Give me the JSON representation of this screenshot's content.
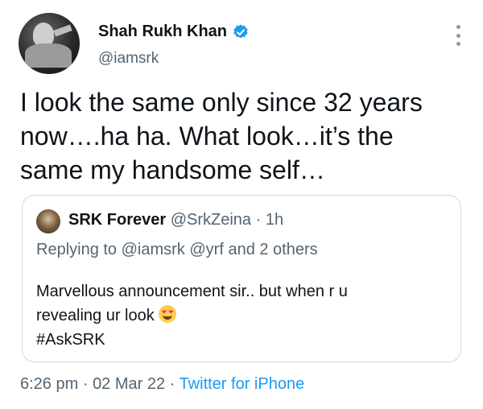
{
  "tweet": {
    "author_name": "Shah Rukh Khan",
    "author_handle": "@iamsrk",
    "text_line1": "I look the same only since 32 years",
    "text_line2": "now….ha ha. What look…it’s the",
    "text_line3": "same my handsome self…",
    "time": "6:26 pm",
    "date": "02 Mar 22",
    "source": "Twitter for iPhone",
    "separator": "·"
  },
  "quoted": {
    "author_name": "SRK Forever",
    "author_handle": "@SrkZeina",
    "age": "1h",
    "separator": "·",
    "replying_prefix": "Replying to",
    "replying_to": "@iamsrk @yrf and 2 others",
    "body_line1": "Marvellous announcement sir.. but when r u",
    "body_line2": "revealing ur look",
    "body_line3": "#AskSRK"
  },
  "icons": {
    "verified": "verified-badge-icon",
    "more": "more-options-icon",
    "emoji": "heart-eyes-emoji"
  },
  "colors": {
    "verified": "#1d9bf0",
    "link": "#1d9bf0",
    "secondary_text": "#536471",
    "border": "#cfd9de"
  }
}
